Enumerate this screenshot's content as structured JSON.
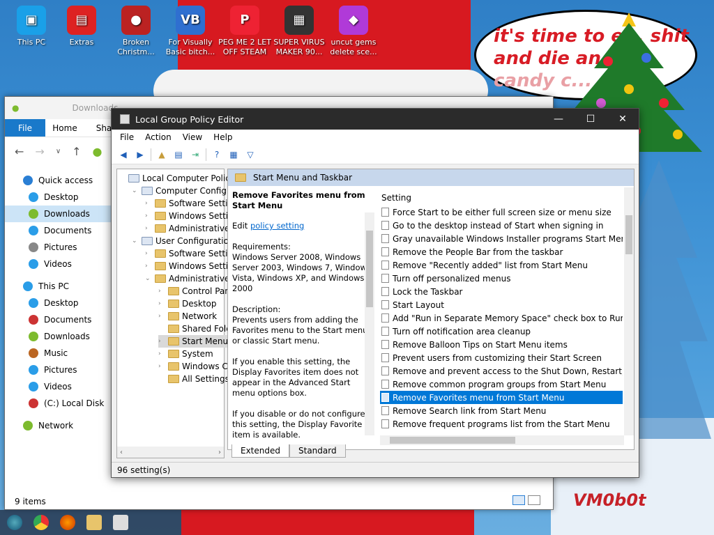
{
  "desktop": {
    "icons": [
      {
        "label": "This PC",
        "glyph": "▣",
        "color": "#1aa0e8"
      },
      {
        "label": "Extras",
        "glyph": "▤",
        "color": "#d22"
      },
      {
        "label": "Broken Christm...",
        "glyph": "●",
        "color": "#b22"
      },
      {
        "label": "For Visually Basic bitch...",
        "glyph": "VB",
        "color": "#2f6fd0"
      },
      {
        "label": "PEG ME 2 LET OFF STEAM",
        "glyph": "P",
        "color": "#e23"
      },
      {
        "label": "SUPER VIRUS MAKER 90...",
        "glyph": "▦",
        "color": "#333"
      },
      {
        "label": "uncut gems delete sce...",
        "glyph": "◆",
        "color": "#b03ad8"
      }
    ],
    "speech_bubble": {
      "line1": "it's time to e... shit",
      "line2": "and die an... w",
      "line3": "candy c..."
    },
    "signature": "VM0b0t"
  },
  "explorer": {
    "title": "Downloads",
    "ribbon": {
      "file": "File",
      "home": "Home",
      "share": "Sha"
    },
    "sidebar": [
      {
        "label": "Quick access",
        "color": "#2a7fd4"
      },
      {
        "label": "Desktop",
        "color": "#2a9de8"
      },
      {
        "label": "Downloads",
        "color": "#7dbb2e"
      },
      {
        "label": "Documents",
        "color": "#2a9de8"
      },
      {
        "label": "Pictures",
        "color": "#888"
      },
      {
        "label": "Videos",
        "color": "#2a9de8"
      },
      {
        "label": "This PC",
        "color": "#2a9de8"
      },
      {
        "label": "Desktop",
        "color": "#2a9de8"
      },
      {
        "label": "Documents",
        "color": "#c33"
      },
      {
        "label": "Downloads",
        "color": "#7dbb2e"
      },
      {
        "label": "Music",
        "color": "#b62"
      },
      {
        "label": "Pictures",
        "color": "#2a9de8"
      },
      {
        "label": "Videos",
        "color": "#2a9de8"
      },
      {
        "label": "(C:) Local Disk",
        "color": "#c33"
      },
      {
        "label": "Network",
        "color": "#7dbb2e"
      }
    ],
    "status": "9 items"
  },
  "gpedit": {
    "title": "Local Group Policy Editor",
    "menu": [
      "File",
      "Action",
      "View",
      "Help"
    ],
    "tree": [
      {
        "label": "Local Computer Policy",
        "depth": 0,
        "arrow": ""
      },
      {
        "label": "Computer Configura",
        "depth": 1,
        "arrow": "v"
      },
      {
        "label": "Software Settings",
        "depth": 2,
        "arrow": ">"
      },
      {
        "label": "Windows Setting",
        "depth": 2,
        "arrow": ">"
      },
      {
        "label": "Administrative Te",
        "depth": 2,
        "arrow": ">"
      },
      {
        "label": "User Configuration",
        "depth": 1,
        "arrow": "v"
      },
      {
        "label": "Software Settings",
        "depth": 2,
        "arrow": ">"
      },
      {
        "label": "Windows Setting",
        "depth": 2,
        "arrow": ">"
      },
      {
        "label": "Administrative Te",
        "depth": 2,
        "arrow": "v"
      },
      {
        "label": "Control Panel",
        "depth": 3,
        "arrow": ">"
      },
      {
        "label": "Desktop",
        "depth": 3,
        "arrow": ">"
      },
      {
        "label": "Network",
        "depth": 3,
        "arrow": ">"
      },
      {
        "label": "Shared Folder",
        "depth": 3,
        "arrow": ""
      },
      {
        "label": "Start Menu ar",
        "depth": 3,
        "arrow": ">"
      },
      {
        "label": "System",
        "depth": 3,
        "arrow": ">"
      },
      {
        "label": "Windows Cor",
        "depth": 3,
        "arrow": ">"
      },
      {
        "label": "All Settings",
        "depth": 3,
        "arrow": ""
      }
    ],
    "pane_header": "Start Menu and Taskbar",
    "description": {
      "heading": "Remove Favorites menu from Start Menu",
      "edit_prefix": "Edit",
      "edit_link": "policy setting",
      "requirements": "Requirements:\nWindows Server 2008, Windows Server 2003, Windows 7, Windows Vista, Windows XP, and Windows 2000",
      "description": "Description:\nPrevents users from adding the Favorites menu to the Start menu or classic Start menu.",
      "enable": "If you enable this setting, the Display Favorites item does not appear in the Advanced Start menu options box.",
      "disable": "If you disable or do not configure this setting, the Display Favorite item is available."
    },
    "list_header": "Setting",
    "settings": [
      "Force Start to be either full screen size or menu size",
      "Go to the desktop instead of Start when signing in",
      "Gray unavailable Windows Installer programs Start Menu sh...",
      "Remove the People Bar from the taskbar",
      "Remove \"Recently added\" list from Start Menu",
      "Turn off personalized menus",
      "Lock the Taskbar",
      "Start Layout",
      "Add \"Run in Separate Memory Space\" check box to Run dial...",
      "Turn off notification area cleanup",
      "Remove Balloon Tips on Start Menu items",
      "Prevent users from customizing their Start Screen",
      "Remove and prevent access to the Shut Down, Restart, Sleep...",
      "Remove common program groups from Start Menu",
      "Remove Favorites menu from Start Menu",
      "Remove Search link from Start Menu",
      "Remove frequent programs list from the Start Menu"
    ],
    "selected_index": 14,
    "tabs": [
      "Extended",
      "Standard"
    ],
    "status": "96 setting(s)"
  }
}
